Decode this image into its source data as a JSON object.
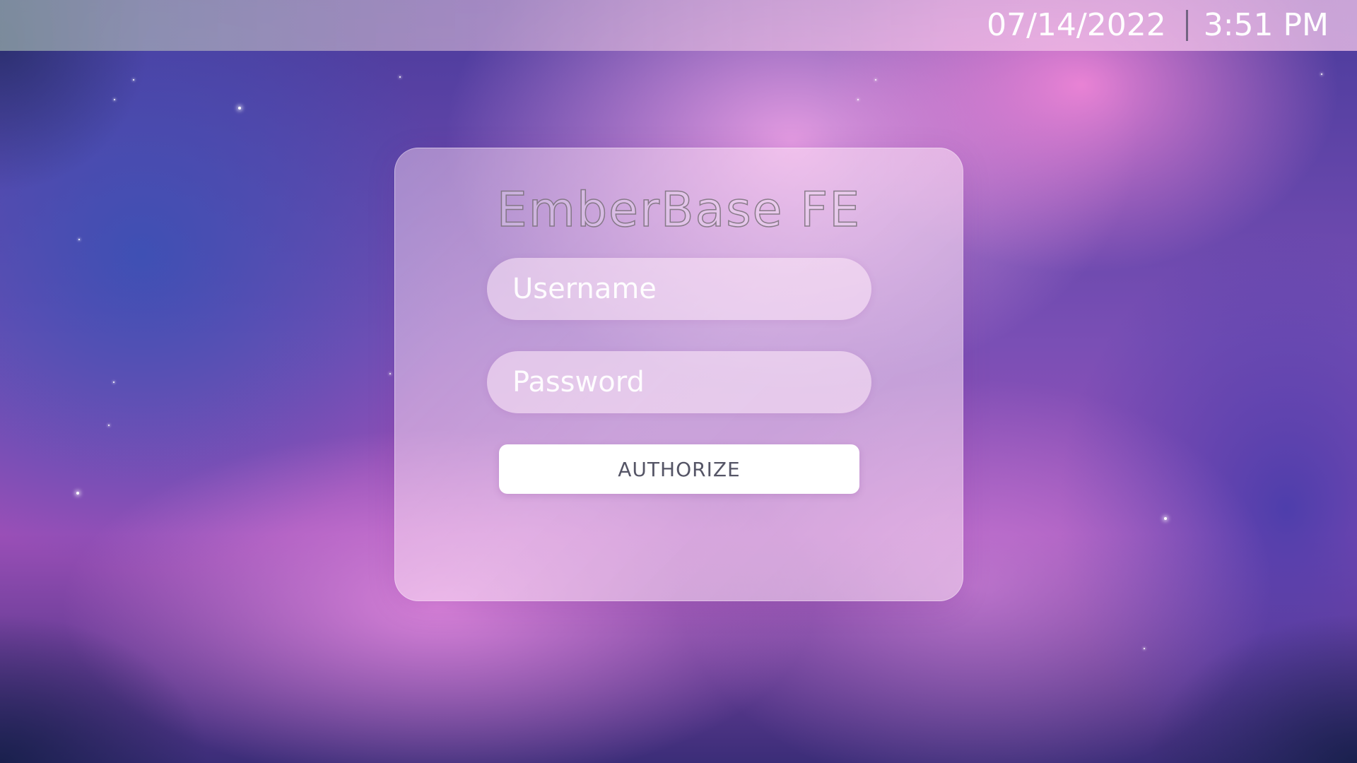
{
  "status_bar": {
    "date": "07/14/2022",
    "time": "3:51 PM"
  },
  "login": {
    "title": "EmberBase FE",
    "username_placeholder": "Username",
    "username_value": "",
    "password_placeholder": "Password",
    "password_value": "",
    "authorize_label": "AUTHORIZE"
  },
  "colors": {
    "background_primary": "#8e4fb8",
    "background_glow": "#f090d8",
    "card_tint": "#f6d8f0",
    "button_bg": "#ffffff",
    "button_text": "#555566"
  }
}
